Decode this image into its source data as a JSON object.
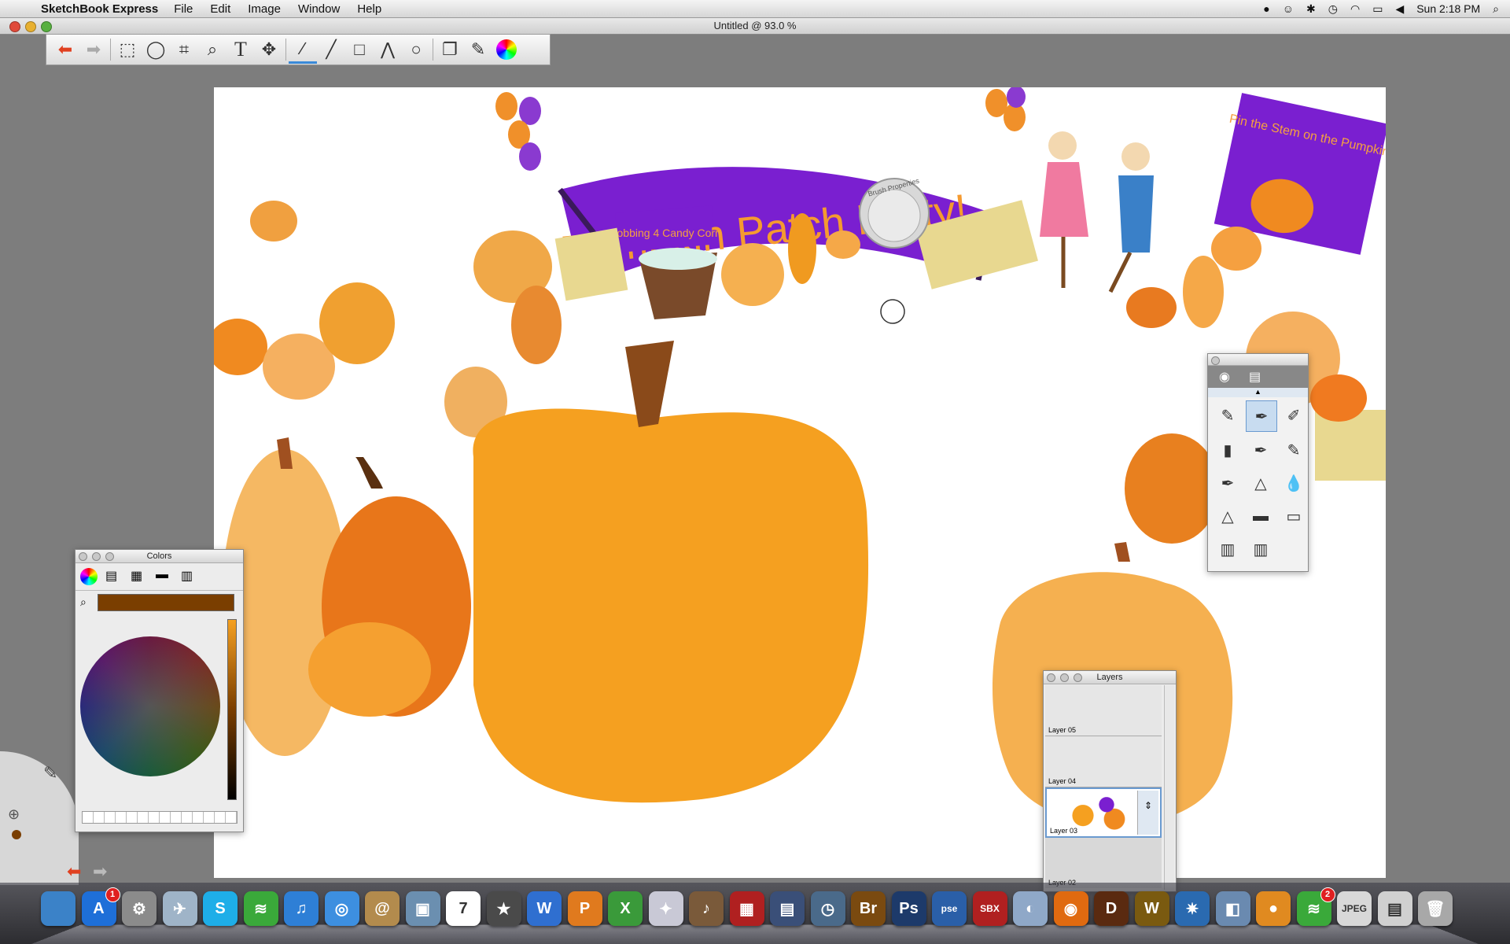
{
  "menubar": {
    "app": "SketchBook Express",
    "items": [
      "File",
      "Edit",
      "Image",
      "Window",
      "Help"
    ],
    "clock": "Sun 2:18 PM"
  },
  "window": {
    "title": "Untitled @ 93.0 %"
  },
  "toolbar": {
    "tools": [
      "undo-icon",
      "redo-icon",
      "rect-select-icon",
      "lasso-icon",
      "crop-icon",
      "zoom-icon",
      "text-icon",
      "move-icon",
      "freehand-icon",
      "line-icon",
      "rectangle-icon",
      "polyline-icon",
      "ellipse-icon",
      "copy-icon",
      "brushes-icon",
      "color-wheel-icon"
    ]
  },
  "artwork": {
    "banner": "Pumpkin Patch Party!",
    "sign": "Bobbing 4 Candy Corn",
    "poster": "Pin the Stem on the Pumpkin",
    "puck_label": "Brush Properties"
  },
  "colors_panel": {
    "title": "Colors",
    "current_color": "#7a3e00"
  },
  "layers_panel": {
    "title": "Layers",
    "layers": [
      "Layer 05",
      "Layer 04",
      "Layer 03",
      "Layer 02"
    ],
    "selected": "Layer 03"
  },
  "dock": {
    "apps": [
      {
        "name": "finder",
        "label": "",
        "color": "#3b82c8"
      },
      {
        "name": "app-store",
        "label": "A",
        "color": "#1e6fd8",
        "badge": "1"
      },
      {
        "name": "system-preferences",
        "label": "⚙",
        "color": "#8b8b8b"
      },
      {
        "name": "mail-bird",
        "label": "✈",
        "color": "#9fb4c8"
      },
      {
        "name": "skype",
        "label": "S",
        "color": "#1eaee8"
      },
      {
        "name": "spotify",
        "label": "≋",
        "color": "#3aa93a"
      },
      {
        "name": "itunes",
        "label": "♫",
        "color": "#2e7fd6"
      },
      {
        "name": "safari",
        "label": "◎",
        "color": "#3d8fe0"
      },
      {
        "name": "address-book",
        "label": "@",
        "color": "#b38b4d"
      },
      {
        "name": "iphoto",
        "label": "▣",
        "color": "#6b8fb0"
      },
      {
        "name": "ical",
        "label": "7",
        "color": "#ffffff"
      },
      {
        "name": "imovie",
        "label": "★",
        "color": "#4a4a4a"
      },
      {
        "name": "word",
        "label": "W",
        "color": "#2f6fd0"
      },
      {
        "name": "powerpoint",
        "label": "P",
        "color": "#e07a1e"
      },
      {
        "name": "excel",
        "label": "X",
        "color": "#3a9a3a"
      },
      {
        "name": "magic-wand",
        "label": "✦",
        "color": "#c9c9d6"
      },
      {
        "name": "garageband",
        "label": "♪",
        "color": "#7a5a3a"
      },
      {
        "name": "photo-booth",
        "label": "▦",
        "color": "#b02020"
      },
      {
        "name": "dashboard",
        "label": "▤",
        "color": "#3a4f78"
      },
      {
        "name": "time-machine",
        "label": "◷",
        "color": "#4a6a8a"
      },
      {
        "name": "bridge",
        "label": "Br",
        "color": "#7a4a10"
      },
      {
        "name": "photoshop",
        "label": "Ps",
        "color": "#1d3a6a"
      },
      {
        "name": "photoshop-elements",
        "label": "pse",
        "color": "#2a5fa8"
      },
      {
        "name": "sketchbook",
        "label": "SBX",
        "color": "#b02020"
      },
      {
        "name": "pidgin",
        "label": "◐",
        "color": "#8fa8c8"
      },
      {
        "name": "firefox",
        "label": "◉",
        "color": "#e06a10"
      },
      {
        "name": "diablo",
        "label": "D",
        "color": "#5a2a10"
      },
      {
        "name": "warcraft",
        "label": "W",
        "color": "#7a5a10"
      },
      {
        "name": "battle-net",
        "label": "✷",
        "color": "#2a6ab0"
      },
      {
        "name": "preview",
        "label": "◧",
        "color": "#6a8ab0"
      },
      {
        "name": "growl",
        "label": "●",
        "color": "#e08a20"
      },
      {
        "name": "spotify-2",
        "label": "≋",
        "color": "#3aa93a",
        "badge": "2"
      },
      {
        "name": "jpeg-doc",
        "label": "JPEG",
        "color": "#d8d8d8"
      },
      {
        "name": "downloads",
        "label": "▤",
        "color": "#d0d0d0"
      },
      {
        "name": "trash",
        "label": "🗑",
        "color": "#a8a8a8"
      }
    ]
  }
}
